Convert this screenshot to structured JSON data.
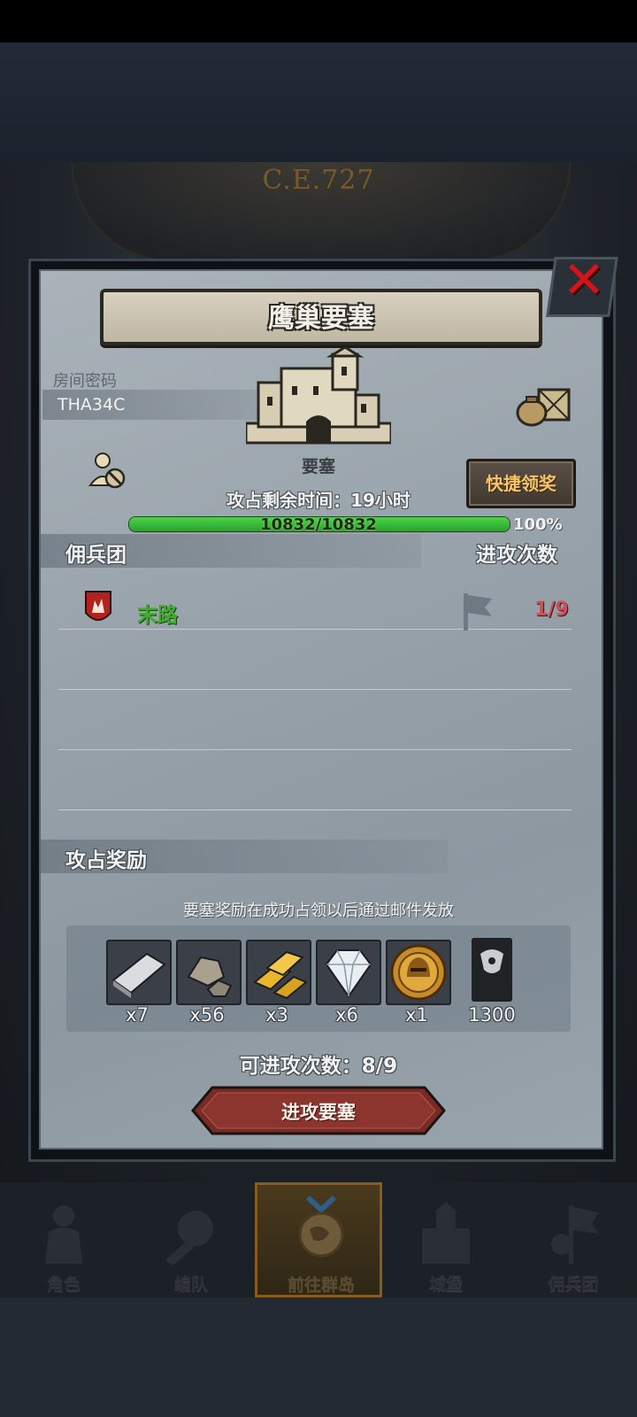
{
  "hud": {
    "era": "C.E.727"
  },
  "dialog": {
    "title": "鹰巢要塞",
    "room_label": "房间密码",
    "room_code": "THA34C",
    "building_label": "要塞",
    "quick_claim_label": "快捷领奖",
    "remaining_time": "攻占剩余时间：19小时",
    "hp": {
      "current": 10832,
      "max": 10832,
      "text": "10832/10832",
      "percent_text": "100%"
    },
    "mercenary_header": "佣兵团",
    "attacks_header": "进攻次数",
    "mercenaries": [
      {
        "name": "末路",
        "attacks": "1/9"
      }
    ],
    "reward_header": "攻占奖励",
    "reward_note": "要塞奖励在成功占领以后通过邮件发放",
    "rewards": [
      {
        "icon": "silver-ingot-icon",
        "qty": "x7"
      },
      {
        "icon": "stone-ore-icon",
        "qty": "x56"
      },
      {
        "icon": "gold-bars-icon",
        "qty": "x3"
      },
      {
        "icon": "diamond-icon",
        "qty": "x6"
      },
      {
        "icon": "helmet-medal-icon",
        "qty": "x1"
      },
      {
        "icon": "banner-icon",
        "qty": "1300"
      }
    ],
    "attacks_left": "可进攻次数：8/9",
    "attack_button": "进攻要塞",
    "close": "✕"
  },
  "nav": [
    {
      "label": "角色",
      "icon": "knight-icon"
    },
    {
      "label": "编队",
      "icon": "formation-icon"
    },
    {
      "label": "前往群岛",
      "icon": "compass-globe-icon",
      "active": true
    },
    {
      "label": "城堡",
      "icon": "castle-icon"
    },
    {
      "label": "佣兵团",
      "icon": "mercenary-flag-icon"
    }
  ],
  "colors": {
    "hp_bar": "#3cc23e",
    "merc_name": "#3fae2c",
    "attack_count": "#c8505a",
    "quick_claim_text": "#f6c56b",
    "close_x": "#d3141a"
  }
}
